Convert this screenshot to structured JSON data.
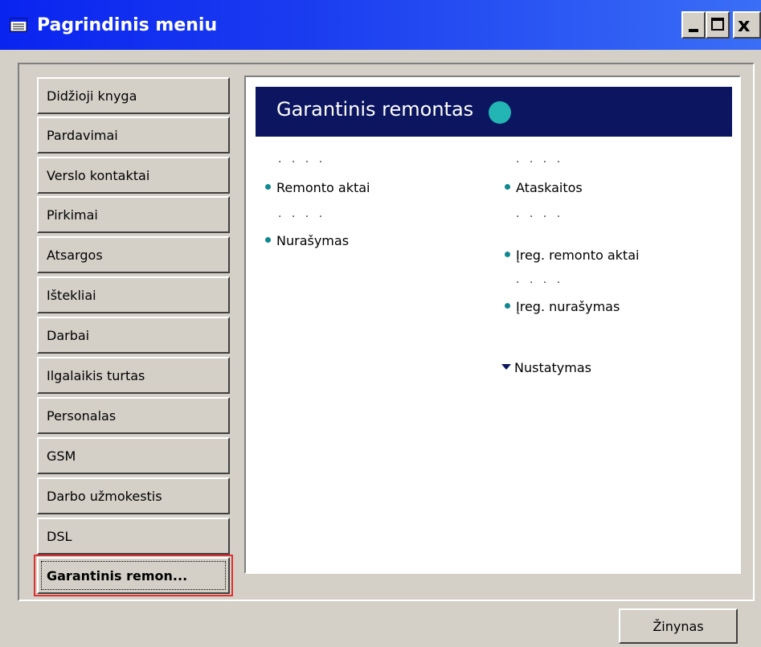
{
  "window": {
    "title": "Pagrindinis meniu",
    "controls": {
      "minimize": "_",
      "maximize": "□",
      "close": "x"
    }
  },
  "nav": {
    "items": [
      {
        "label": "Didžioji knyga"
      },
      {
        "label": "Pardavimai"
      },
      {
        "label": "Verslo kontaktai"
      },
      {
        "label": "Pirkimai"
      },
      {
        "label": "Atsargos"
      },
      {
        "label": "Ištekliai"
      },
      {
        "label": "Darbai"
      },
      {
        "label": "Ilgalaikis turtas"
      },
      {
        "label": "Personalas"
      },
      {
        "label": "GSM"
      },
      {
        "label": "Darbo užmokestis"
      },
      {
        "label": "DSL"
      },
      {
        "label": "Garantinis remon...",
        "active": true
      }
    ]
  },
  "content": {
    "banner_title": "Garantinis remontas",
    "left_column": {
      "dots1": ". . . .",
      "item1": "Remonto aktai",
      "dots2": ". . . .",
      "item2": "Nurašymas"
    },
    "right_column": {
      "dots1": ". . . .",
      "item1": "Ataskaitos",
      "dots2": ". . . .",
      "item2": "Įreg. remonto aktai",
      "dots3": ". . . .",
      "item3": "Įreg. nurašymas",
      "submenu": "Nustatymas"
    }
  },
  "footer": {
    "help_button": "Žinynas"
  },
  "colors": {
    "titlebar": "#0a24f0",
    "banner": "#0c1660",
    "bullet": "#108890",
    "active_highlight": "#e03030"
  }
}
